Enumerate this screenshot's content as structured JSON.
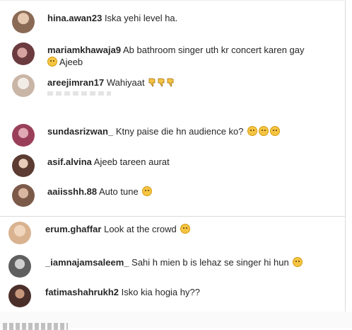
{
  "comments_top": [
    {
      "username": "hina.awan23",
      "text": "Iska yehi level ha.",
      "emojis": [],
      "avatar_color": "#8a6a55"
    },
    {
      "username": "mariamkhawaja9",
      "text": "Ab bathroom singer uth kr concert karen gay",
      "text2": "Ajeeb",
      "emojis": [
        "confused-face-emoji"
      ],
      "avatar_color": "#6b3b3f"
    },
    {
      "username": "areejimran17",
      "text": "Wahiyaat",
      "emojis": [
        "thumbs-down-emoji",
        "thumbs-down-emoji",
        "thumbs-down-emoji"
      ],
      "avatar_color": "#c9b5a6"
    },
    {
      "username": "sundasrizwan_",
      "text": "Ktny paise die hn audience ko?",
      "emojis": [
        "laughing-tears-emoji",
        "laughing-tears-emoji",
        "laughing-tears-emoji"
      ],
      "avatar_color": "#9a3f5a"
    },
    {
      "username": "asif.alvina",
      "text": "Ajeeb tareen aurat",
      "emojis": [],
      "avatar_color": "#5b3b32"
    },
    {
      "username": "aaiisshh.88",
      "text": "Auto tune",
      "emojis": [
        "winking-tongue-emoji"
      ],
      "avatar_color": "#7b5a4a"
    }
  ],
  "comments_bottom": [
    {
      "username": "erum.ghaffar",
      "text": "Look at the crowd",
      "emojis": [
        "frowning-face-emoji"
      ],
      "avatar_color": "#d9b28f"
    },
    {
      "username": "_iamnajamsaleem_",
      "text": "Sahi h mien b is lehaz se singer hi hun",
      "emojis": [
        "grimace-face-emoji"
      ],
      "avatar_color": "#5f5f5f"
    },
    {
      "username": "fatimashahrukh2",
      "text": "Isko kia hogia hy??",
      "emojis": [],
      "avatar_color": "#4a2f2a"
    }
  ],
  "colors": {
    "text": "#262626",
    "divider": "#dbdbdb",
    "emoji_yellow": "#f5c542"
  }
}
